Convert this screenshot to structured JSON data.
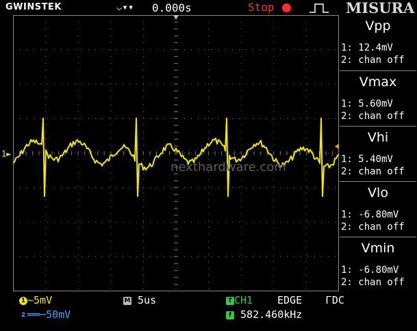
{
  "header": {
    "brand": "GWINSTEK",
    "trigger_position": "0.000s",
    "run_state": "Stop",
    "overlay_title": "MISURA"
  },
  "watermark": "nexthardware.com",
  "channel_marker": "1",
  "measurements": [
    {
      "name": "Vpp",
      "ch1": "1: 12.4mV",
      "ch2": "2: chan off"
    },
    {
      "name": "Vmax",
      "ch1": "1: 5.60mV",
      "ch2": "2: chan off"
    },
    {
      "name": "Vhi",
      "ch1": "1: 5.40mV",
      "ch2": "2: chan off"
    },
    {
      "name": "Vlo",
      "ch1": "1: -6.80mV",
      "ch2": "2: chan off"
    },
    {
      "name": "Vmin",
      "ch1": "1: -6.80mV",
      "ch2": "2: chan off"
    }
  ],
  "status": {
    "ch1_scale": "~5mV",
    "ch2_scale": "══─50mV",
    "timebase": "5us",
    "trigger_source": "CH1",
    "trigger_type": "EDGE",
    "coupling": "DC",
    "frequency": "582.460kHz"
  },
  "colors": {
    "ch1": "#f5e800",
    "ch2": "#3aa6ff",
    "grid": "#8a8a8a",
    "trigger_badge": "#2ecc40",
    "stop": "#ff2a2a"
  },
  "icons": [
    "trigger-arrows-icon",
    "stop-dot-icon",
    "rising-edge-icon",
    "ch1-badge-icon",
    "ch2-badge-icon",
    "math-badge-icon",
    "trigger-badge-icon",
    "frequency-badge-icon",
    "dc-coupling-icon"
  ]
}
